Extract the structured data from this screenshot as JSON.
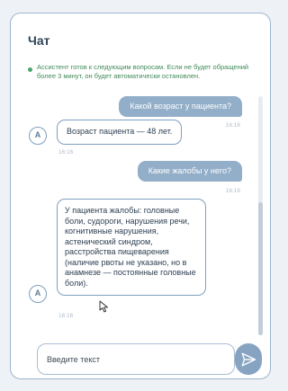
{
  "chat": {
    "title": "Чат",
    "status_text": "Ассистент готов к следующим вопросам. Если не будет обращений более 3 минут, он будет автоматически остановлен.",
    "status_color": "#47a86a",
    "accent_color": "#92aec8",
    "avatar_letter": "A"
  },
  "messages": [
    {
      "role": "user",
      "text": "Какой возраст у пациента?",
      "time": "16:16"
    },
    {
      "role": "assistant",
      "text": "Возраст пациента — 48 лет.",
      "time": "16:16"
    },
    {
      "role": "user",
      "text": "Какие жалобы у него?",
      "time": "16:16"
    },
    {
      "role": "assistant",
      "lines": [
        "У пациента жалобы: головные",
        "боли, судороги, нарушения речи,",
        "когнитивные нарушения,",
        "астенический синдром,",
        "расстройства пищеварения",
        "(наличие рвоты не указано, но в",
        "анамнезе — постоянные головные",
        "боли)."
      ],
      "time": "16:16"
    }
  ],
  "composer": {
    "placeholder": "Введите текст",
    "value": "",
    "send_icon": "send-icon"
  }
}
